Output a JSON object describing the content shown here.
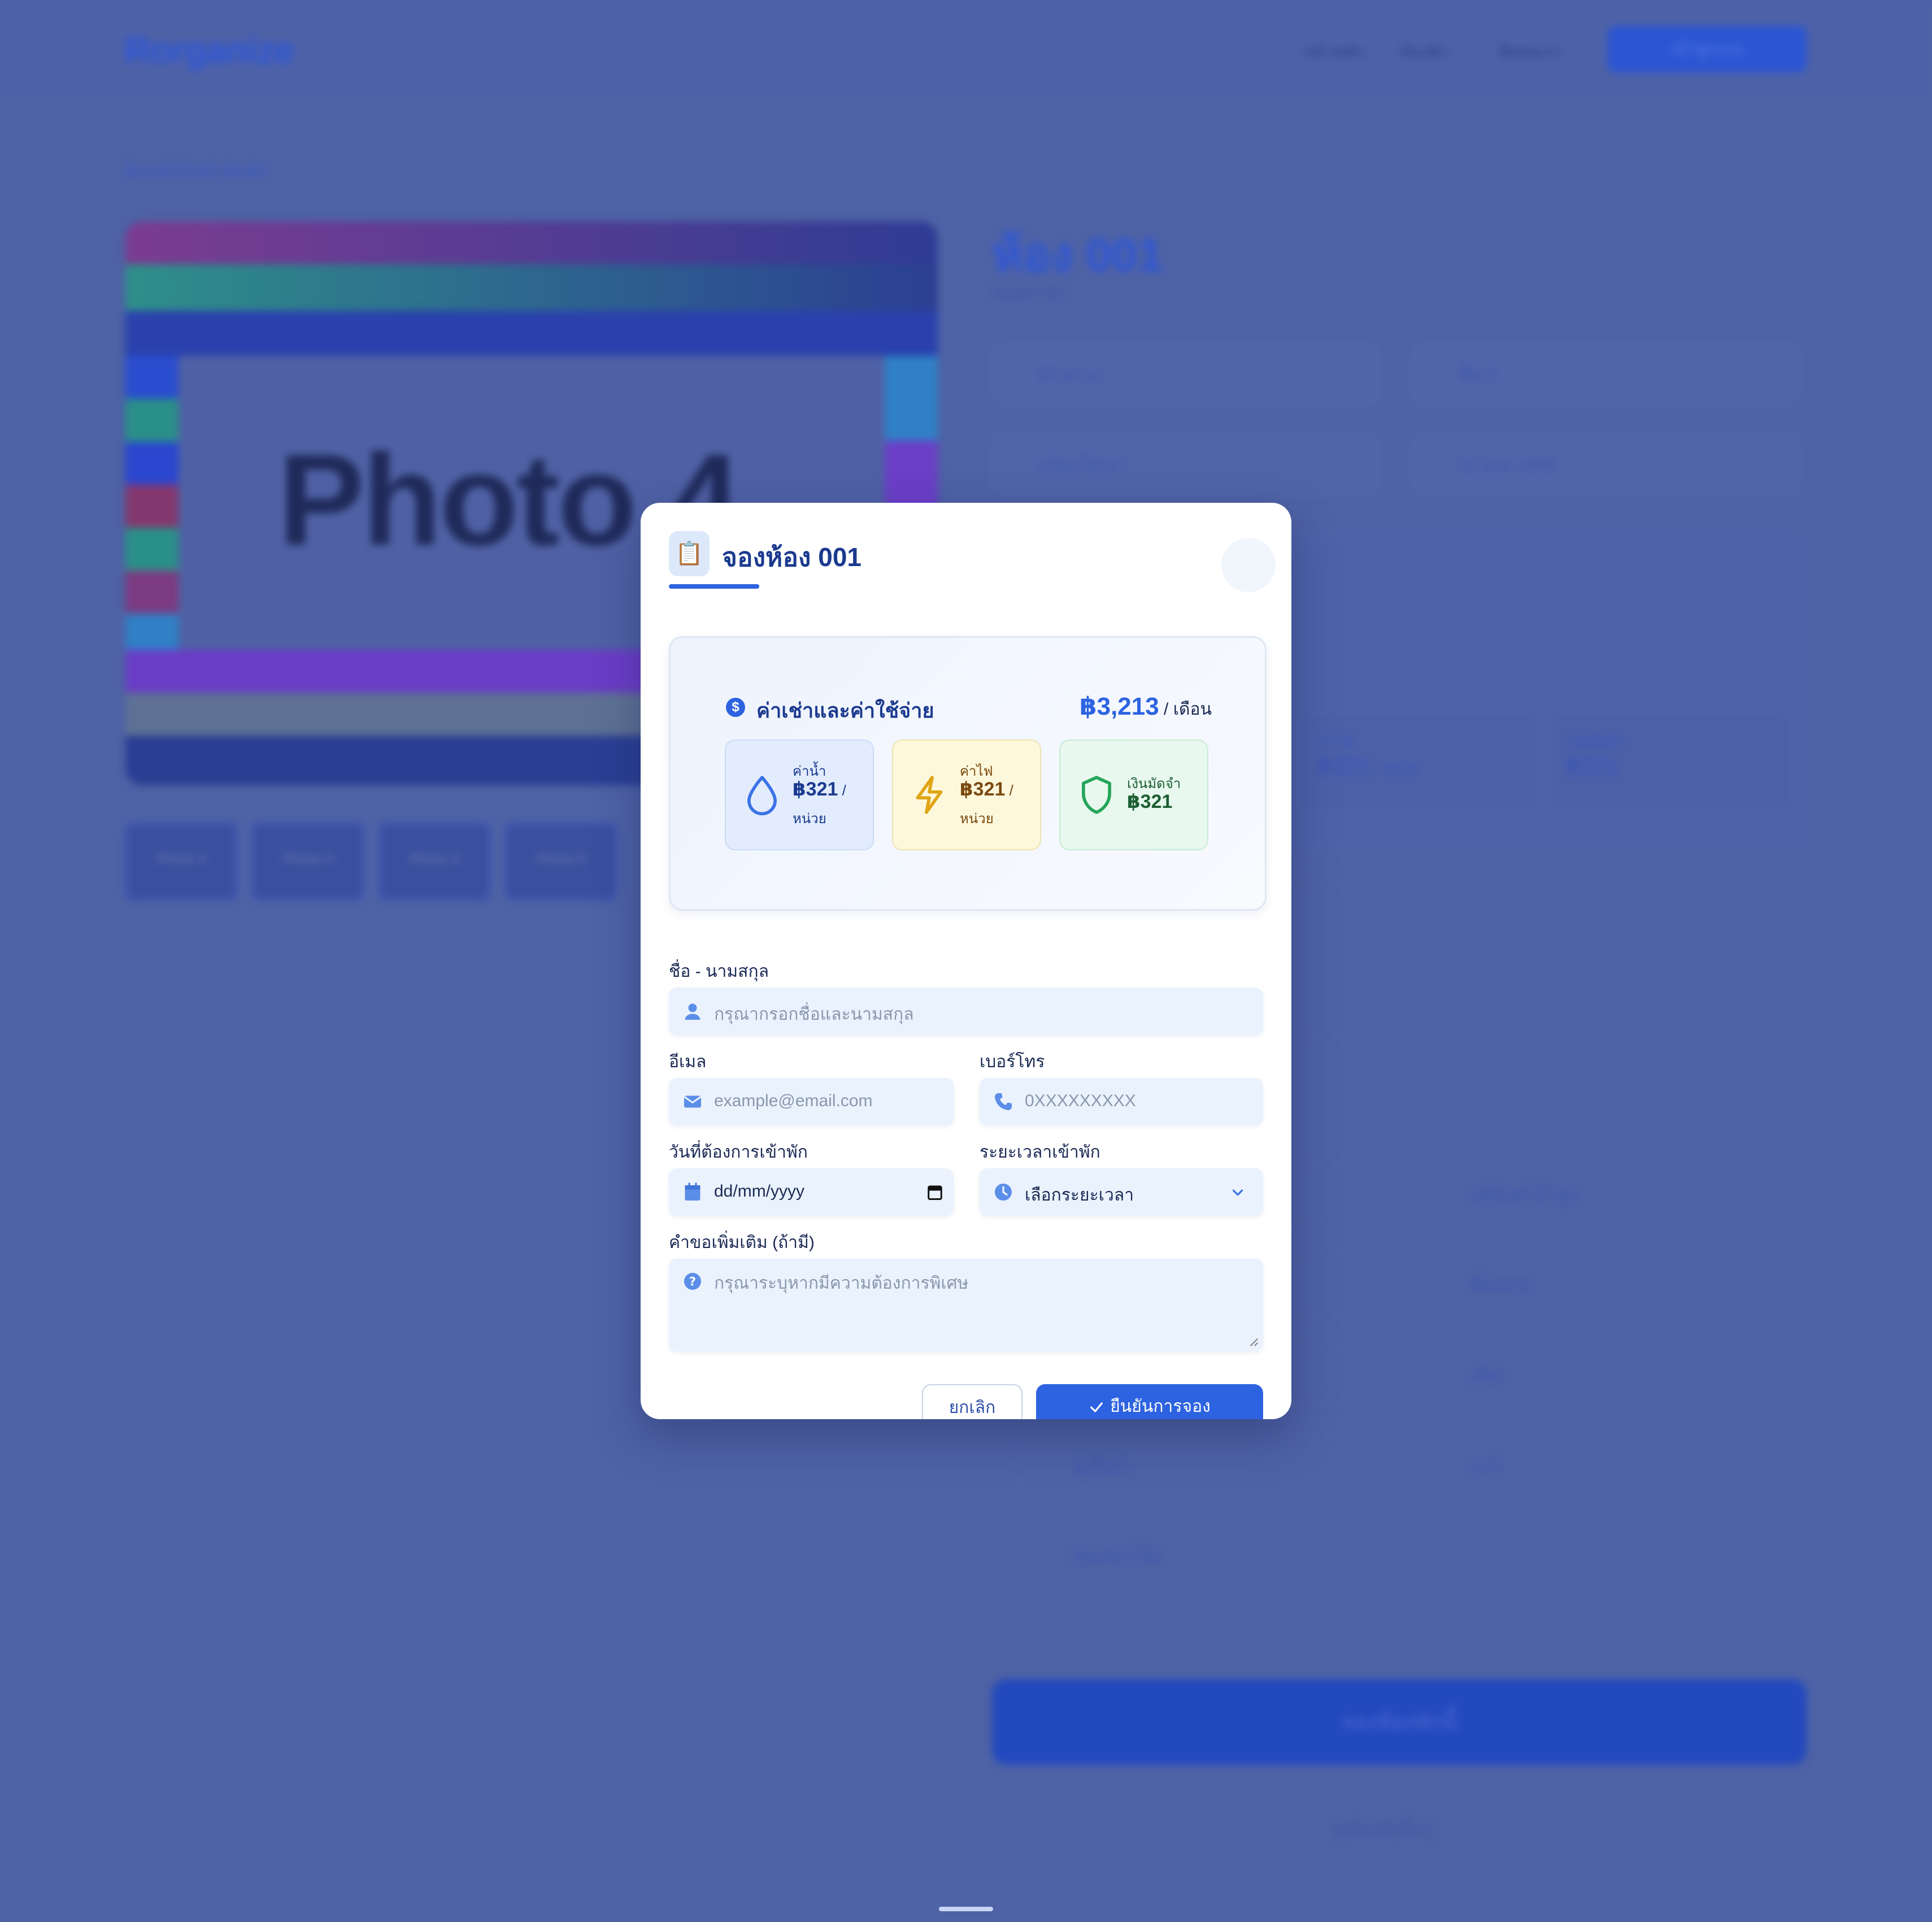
{
  "background": {
    "logo": "Rorganize",
    "nav": [
      "หน้าหลัก",
      "ห้องพัก",
      "ติดต่อเรา"
    ],
    "nav_button": "เข้าสู่ระบบ",
    "breadcrumb": "ย้อนกลับไปหน้าห้องพัก",
    "photo_label": "Photo 4",
    "thumbnails": [
      "Photo 3",
      "Photo 4",
      "Photo 4",
      "Photo 5"
    ],
    "room_title": "ห้อง 001",
    "room_subtitle": "ห้องพัก 001",
    "info": [
      "30 ตร.ม.",
      "ชั้น 3",
      "พร้อมให้เช่า",
      "01 ม.ค. 2025"
    ],
    "mini_cards": [
      {
        "label": "ค่าไฟ",
        "value": "฿321",
        "unit": "/ หน่วย"
      },
      {
        "label": "เงินมัดจำ",
        "value": "฿321"
      }
    ],
    "amenities": [
      "เครื่องทำน้ำอุ่น",
      "ที่จอดรถ",
      "เตียง",
      "ตู้เสื้อผ้า",
      "แอร์",
      "อินเทอร์เน็ต"
    ],
    "book_button": "จองห้องพักนี้",
    "footer_link": "ดูห้องพักอื่นๆ"
  },
  "modal": {
    "icon": "📋",
    "title": "จองห้อง 001",
    "cost": {
      "title": "ค่าเช่าและค่าใช้จ่าย",
      "price": "฿3,213",
      "price_unit": " / เดือน",
      "water": {
        "label": "ค่าน้ำ",
        "value": "฿321",
        "per": " /",
        "unit": "หน่วย"
      },
      "electric": {
        "label": "ค่าไฟ",
        "value": "฿321",
        "per": " /",
        "unit": "หน่วย"
      },
      "deposit": {
        "label": "เงินมัดจำ",
        "value": "฿321"
      }
    },
    "form": {
      "name_label": "ชื่อ - นามสกุล",
      "name_placeholder": "กรุณากรอกชื่อและนามสกุล",
      "email_label": "อีเมล",
      "email_placeholder": "example@email.com",
      "phone_label": "เบอร์โทร",
      "phone_placeholder": "0XXXXXXXXX",
      "date_label": "วันที่ต้องการเข้าพัก",
      "date_value": "dd/mm/yyyy",
      "duration_label": "ระยะเวลาเข้าพัก",
      "duration_value": "เลือกระยะเวลา",
      "note_label": "คำขอเพิ่มเติม (ถ้ามี)",
      "note_placeholder": "กรุณาระบุหากมีความต้องการพิเศษ"
    },
    "cancel": "ยกเลิก",
    "confirm": "ยืนยันการจอง"
  },
  "colors": {
    "accent": "#2d63e0",
    "overlay": "#4e62a5",
    "title": "#1b3a8f"
  }
}
